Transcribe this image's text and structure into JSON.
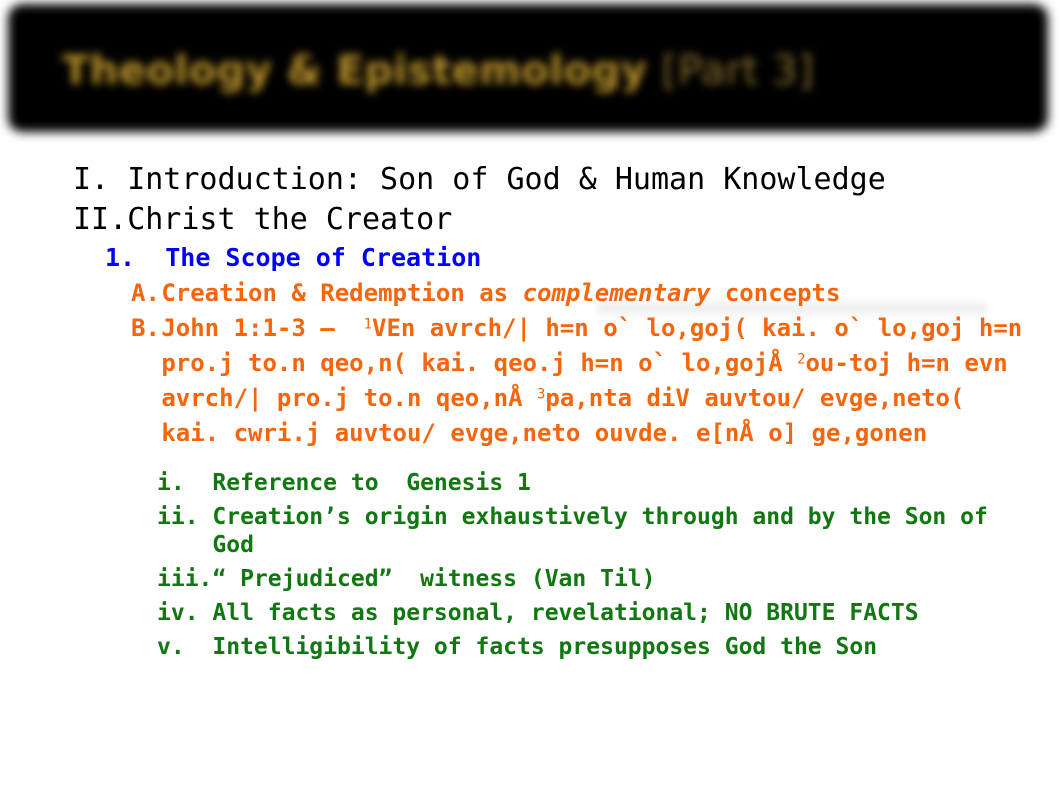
{
  "slide": {
    "title_main": "Theology & Epistemology",
    "title_part": "[Part 3]",
    "title_full": "Theology & Epistemology [Part 3]",
    "background_color": "#ffffff",
    "banner_color": "#000000",
    "title_color": "#b8912a"
  },
  "colors": {
    "level1": "#000000",
    "level2": "#0000ff",
    "level3": "#f4650c",
    "level4": "#117711"
  },
  "outline": {
    "level1": [
      {
        "marker": "I.",
        "text": "Introduction: Son of God & Human Knowledge"
      },
      {
        "marker": "II.",
        "text": "Christ the Creator"
      }
    ],
    "level2": [
      {
        "marker": "1.",
        "text": "The Scope of Creation"
      }
    ],
    "level3": [
      {
        "marker": "A.",
        "text_before": "Creation & Redemption as ",
        "text_italic": "complementary",
        "text_after": " concepts"
      }
    ],
    "scripture": {
      "marker": "B.",
      "reference": "John 1:1-3 –  ",
      "verse1_num": "1",
      "verse1_text": "VEn avrch/| h=n o` lo,goj( kai. o` lo,goj h=n pro.j to.n qeo,n( kai. qeo.j h=n o` lo,gojÅ ",
      "verse2_num": "2",
      "verse2_text": "ou-toj h=n evn avrch/| pro.j to.n qeo,nÅ ",
      "verse3_num": "3",
      "verse3_text": "pa,nta diV auvtou/ evge,neto( kai. cwri.j auvtou/ evge,neto ouvde. e[nÅ o] ge,gonen"
    },
    "level4": [
      {
        "marker": "i.",
        "text": "Reference to  Genesis 1"
      },
      {
        "marker": "ii.",
        "text": "Creation’s origin exhaustively through and by the Son of God"
      },
      {
        "marker": "iii.",
        "text": "“ Prejudiced”  witness (Van Til)"
      },
      {
        "marker": "iv.",
        "text": "All facts as personal, revelational; NO BRUTE FACTS"
      },
      {
        "marker": "v.",
        "text": "Intelligibility of facts presupposes God the Son"
      }
    ]
  }
}
